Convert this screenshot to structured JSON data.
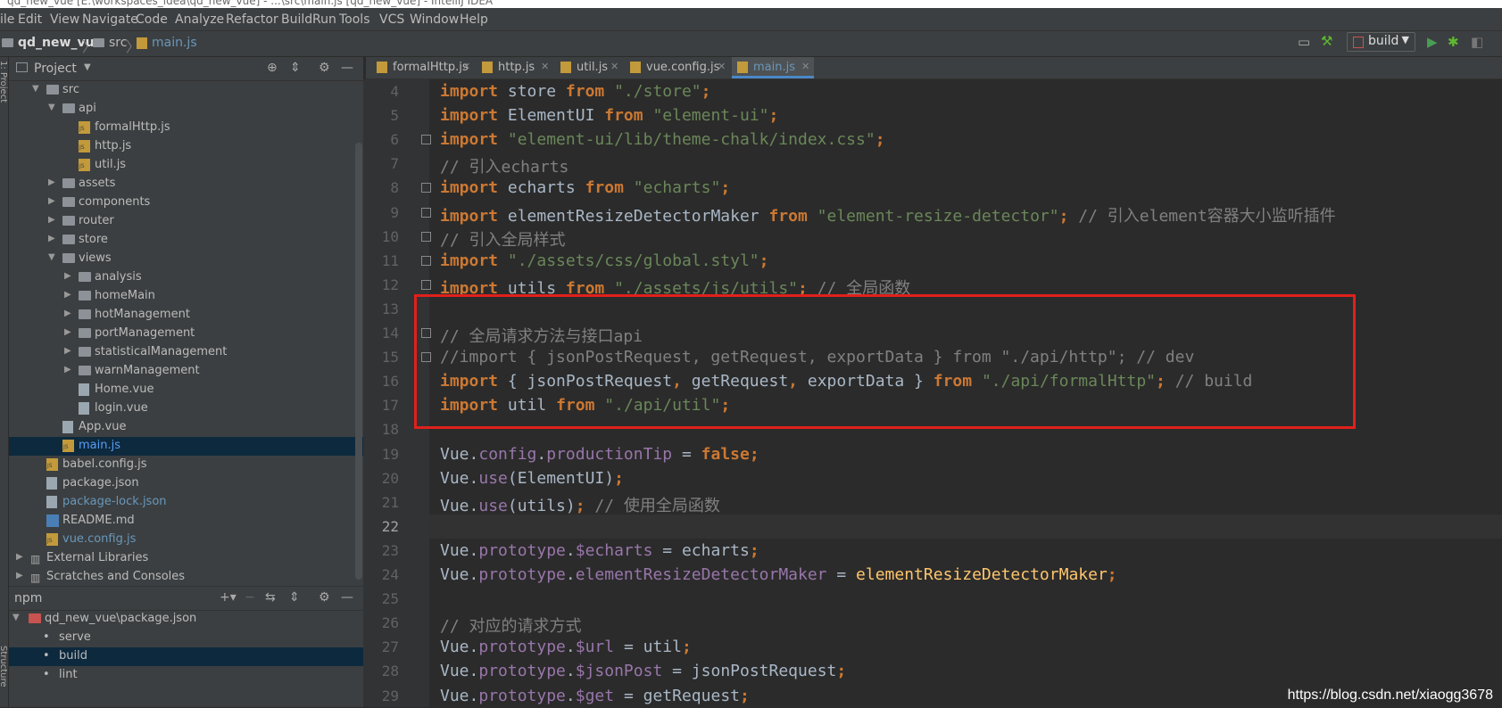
{
  "window_title": "qd_new_vue [E:\\workspaces_idea\\qd_new_vue] - ...\\src\\main.js [qd_new_vue] - IntelliJ IDEA",
  "menu": [
    "ile",
    "Edit",
    "View",
    "Navigate",
    "Code",
    "Analyze",
    "Refactor",
    "Build",
    "Run",
    "Tools",
    "VCS",
    "Window",
    "Help"
  ],
  "breadcrumb": {
    "project": "qd_new_vue",
    "folder": "src",
    "file": "main.js"
  },
  "run_config": {
    "label": "build"
  },
  "side_strip": {
    "project_label": "1: Project",
    "structure_label": "Structure"
  },
  "project_panel": {
    "title": "Project",
    "tree": [
      {
        "label": "src",
        "kind": "folder",
        "depth": 1,
        "expanded": true
      },
      {
        "label": "api",
        "kind": "folder",
        "depth": 2,
        "expanded": true
      },
      {
        "label": "formalHttp.js",
        "kind": "js",
        "depth": 3
      },
      {
        "label": "http.js",
        "kind": "js",
        "depth": 3
      },
      {
        "label": "util.js",
        "kind": "js",
        "depth": 3
      },
      {
        "label": "assets",
        "kind": "folder",
        "depth": 2,
        "expanded": false
      },
      {
        "label": "components",
        "kind": "folder",
        "depth": 2,
        "expanded": false
      },
      {
        "label": "router",
        "kind": "folder",
        "depth": 2,
        "expanded": false
      },
      {
        "label": "store",
        "kind": "folder",
        "depth": 2,
        "expanded": false
      },
      {
        "label": "views",
        "kind": "folder",
        "depth": 2,
        "expanded": true
      },
      {
        "label": "analysis",
        "kind": "folder",
        "depth": 3,
        "expanded": false
      },
      {
        "label": "homeMain",
        "kind": "folder",
        "depth": 3,
        "expanded": false
      },
      {
        "label": "hotManagement",
        "kind": "folder",
        "depth": 3,
        "expanded": false
      },
      {
        "label": "portManagement",
        "kind": "folder",
        "depth": 3,
        "expanded": false
      },
      {
        "label": "statisticalManagement",
        "kind": "folder",
        "depth": 3,
        "expanded": false
      },
      {
        "label": "warnManagement",
        "kind": "folder",
        "depth": 3,
        "expanded": false
      },
      {
        "label": "Home.vue",
        "kind": "file",
        "depth": 3
      },
      {
        "label": "login.vue",
        "kind": "file",
        "depth": 3
      },
      {
        "label": "App.vue",
        "kind": "file",
        "depth": 2
      },
      {
        "label": "main.js",
        "kind": "js",
        "depth": 2,
        "selected": true,
        "color": "#589df6"
      },
      {
        "label": "babel.config.js",
        "kind": "js",
        "depth": 1
      },
      {
        "label": "package.json",
        "kind": "file",
        "depth": 1
      },
      {
        "label": "package-lock.json",
        "kind": "file",
        "depth": 1,
        "color": "#6897bb"
      },
      {
        "label": "README.md",
        "kind": "md",
        "depth": 1
      },
      {
        "label": "vue.config.js",
        "kind": "js",
        "depth": 1,
        "color": "#6897bb"
      },
      {
        "label": "External Libraries",
        "kind": "lib",
        "depth": 0,
        "expanded": false
      },
      {
        "label": "Scratches and Consoles",
        "kind": "lib",
        "depth": 0,
        "expanded": false
      }
    ]
  },
  "npm_panel": {
    "title": "npm",
    "root": "qd_new_vue\\package.json",
    "scripts": [
      {
        "label": "serve",
        "selected": false
      },
      {
        "label": "build",
        "selected": true
      },
      {
        "label": "lint",
        "selected": false
      }
    ]
  },
  "editor_tabs": [
    {
      "label": "formalHttp.js",
      "active": false
    },
    {
      "label": "http.js",
      "active": false
    },
    {
      "label": "util.js",
      "active": false
    },
    {
      "label": "vue.config.js",
      "active": false
    },
    {
      "label": "main.js",
      "active": true
    }
  ],
  "code_lines": [
    {
      "num": "4",
      "tokens": [
        [
          "k",
          "import"
        ],
        [
          "t",
          " store "
        ],
        [
          "k",
          "from"
        ],
        [
          "t",
          " "
        ],
        [
          "s",
          "\"./store\""
        ],
        [
          "k",
          ";"
        ]
      ]
    },
    {
      "num": "5",
      "tokens": [
        [
          "k",
          "import"
        ],
        [
          "t",
          " ElementUI "
        ],
        [
          "k",
          "from"
        ],
        [
          "t",
          " "
        ],
        [
          "s",
          "\"element-ui\""
        ],
        [
          "k",
          ";"
        ]
      ]
    },
    {
      "num": "6",
      "tokens": [
        [
          "k",
          "import"
        ],
        [
          "t",
          " "
        ],
        [
          "s",
          "\"element-ui/lib/theme-chalk/index.css\""
        ],
        [
          "k",
          ";"
        ]
      ]
    },
    {
      "num": "7",
      "tokens": [
        [
          "c",
          "// 引入echarts"
        ]
      ]
    },
    {
      "num": "8",
      "tokens": [
        [
          "k",
          "import"
        ],
        [
          "t",
          " echarts "
        ],
        [
          "k",
          "from"
        ],
        [
          "t",
          " "
        ],
        [
          "s",
          "\"echarts\""
        ],
        [
          "k",
          ";"
        ]
      ]
    },
    {
      "num": "9",
      "tokens": [
        [
          "k",
          "import"
        ],
        [
          "t",
          " elementResizeDetectorMaker "
        ],
        [
          "k",
          "from"
        ],
        [
          "t",
          " "
        ],
        [
          "s",
          "\"element-resize-detector\""
        ],
        [
          "k",
          ";"
        ],
        [
          "c",
          " // 引入element容器大小监听插件"
        ]
      ]
    },
    {
      "num": "10",
      "tokens": [
        [
          "c",
          "// 引入全局样式"
        ]
      ]
    },
    {
      "num": "11",
      "tokens": [
        [
          "k",
          "import"
        ],
        [
          "t",
          " "
        ],
        [
          "s",
          "\"./assets/css/global.styl\""
        ],
        [
          "k",
          ";"
        ]
      ]
    },
    {
      "num": "12",
      "tokens": [
        [
          "k",
          "import"
        ],
        [
          "t",
          " utils "
        ],
        [
          "k",
          "from"
        ],
        [
          "t",
          " "
        ],
        [
          "s",
          "\"./assets/js/utils\""
        ],
        [
          "k",
          ";"
        ],
        [
          "c",
          " // 全局函数"
        ]
      ]
    },
    {
      "num": "13",
      "tokens": []
    },
    {
      "num": "14",
      "tokens": [
        [
          "c",
          "// 全局请求方法与接口api"
        ]
      ]
    },
    {
      "num": "15",
      "tokens": [
        [
          "c",
          "//import { jsonPostRequest, getRequest, exportData } from \"./api/http\"; // dev"
        ]
      ]
    },
    {
      "num": "16",
      "tokens": [
        [
          "k",
          "import"
        ],
        [
          "t",
          " { jsonPostRequest"
        ],
        [
          "k",
          ","
        ],
        [
          "t",
          " getRequest"
        ],
        [
          "k",
          ","
        ],
        [
          "t",
          " exportData } "
        ],
        [
          "k",
          "from"
        ],
        [
          "t",
          " "
        ],
        [
          "s",
          "\"./api/formalHttp\""
        ],
        [
          "k",
          ";"
        ],
        [
          "c",
          " // build"
        ]
      ]
    },
    {
      "num": "17",
      "tokens": [
        [
          "k",
          "import"
        ],
        [
          "t",
          " util "
        ],
        [
          "k",
          "from"
        ],
        [
          "t",
          " "
        ],
        [
          "s",
          "\"./api/util\""
        ],
        [
          "k",
          ";"
        ]
      ]
    },
    {
      "num": "18",
      "tokens": []
    },
    {
      "num": "19",
      "tokens": [
        [
          "t",
          "Vue."
        ],
        [
          "p",
          "config"
        ],
        [
          "t",
          "."
        ],
        [
          "p",
          "productionTip"
        ],
        [
          "t",
          " = "
        ],
        [
          "k",
          "false;"
        ]
      ]
    },
    {
      "num": "20",
      "tokens": [
        [
          "t",
          "Vue."
        ],
        [
          "p",
          "use"
        ],
        [
          "t",
          "(ElementUI)"
        ],
        [
          "k",
          ";"
        ]
      ]
    },
    {
      "num": "21",
      "tokens": [
        [
          "t",
          "Vue."
        ],
        [
          "p",
          "use"
        ],
        [
          "t",
          "(utils)"
        ],
        [
          "k",
          ";"
        ],
        [
          "c",
          " // 使用全局函数"
        ]
      ]
    },
    {
      "num": "22",
      "tokens": [],
      "caret": true
    },
    {
      "num": "23",
      "tokens": [
        [
          "t",
          "Vue."
        ],
        [
          "p",
          "prototype"
        ],
        [
          "t",
          "."
        ],
        [
          "p",
          "$echarts"
        ],
        [
          "t",
          " = echarts"
        ],
        [
          "k",
          ";"
        ]
      ]
    },
    {
      "num": "24",
      "tokens": [
        [
          "t",
          "Vue."
        ],
        [
          "p",
          "prototype"
        ],
        [
          "t",
          "."
        ],
        [
          "p",
          "elementResizeDetectorMaker"
        ],
        [
          "t",
          " = "
        ],
        [
          "v",
          "elementResizeDetectorMaker"
        ],
        [
          "k",
          ";"
        ]
      ]
    },
    {
      "num": "25",
      "tokens": []
    },
    {
      "num": "26",
      "tokens": [
        [
          "c",
          "// 对应的请求方式"
        ]
      ]
    },
    {
      "num": "27",
      "tokens": [
        [
          "t",
          "Vue."
        ],
        [
          "p",
          "prototype"
        ],
        [
          "t",
          "."
        ],
        [
          "p",
          "$url"
        ],
        [
          "t",
          " = util"
        ],
        [
          "k",
          ";"
        ]
      ]
    },
    {
      "num": "28",
      "tokens": [
        [
          "t",
          "Vue."
        ],
        [
          "p",
          "prototype"
        ],
        [
          "t",
          "."
        ],
        [
          "p",
          "$jsonPost"
        ],
        [
          "t",
          " = jsonPostRequest"
        ],
        [
          "k",
          ";"
        ]
      ]
    },
    {
      "num": "29",
      "tokens": [
        [
          "t",
          "Vue."
        ],
        [
          "p",
          "prototype"
        ],
        [
          "t",
          "."
        ],
        [
          "p",
          "$get"
        ],
        [
          "t",
          " = getRequest"
        ],
        [
          "k",
          ";"
        ]
      ]
    }
  ],
  "watermark": "https://blog.csdn.net/xiaogg3678",
  "colors": {
    "accent": "#4a88c7",
    "highlight_box": "#e0201c",
    "selection": "#0d293e"
  }
}
